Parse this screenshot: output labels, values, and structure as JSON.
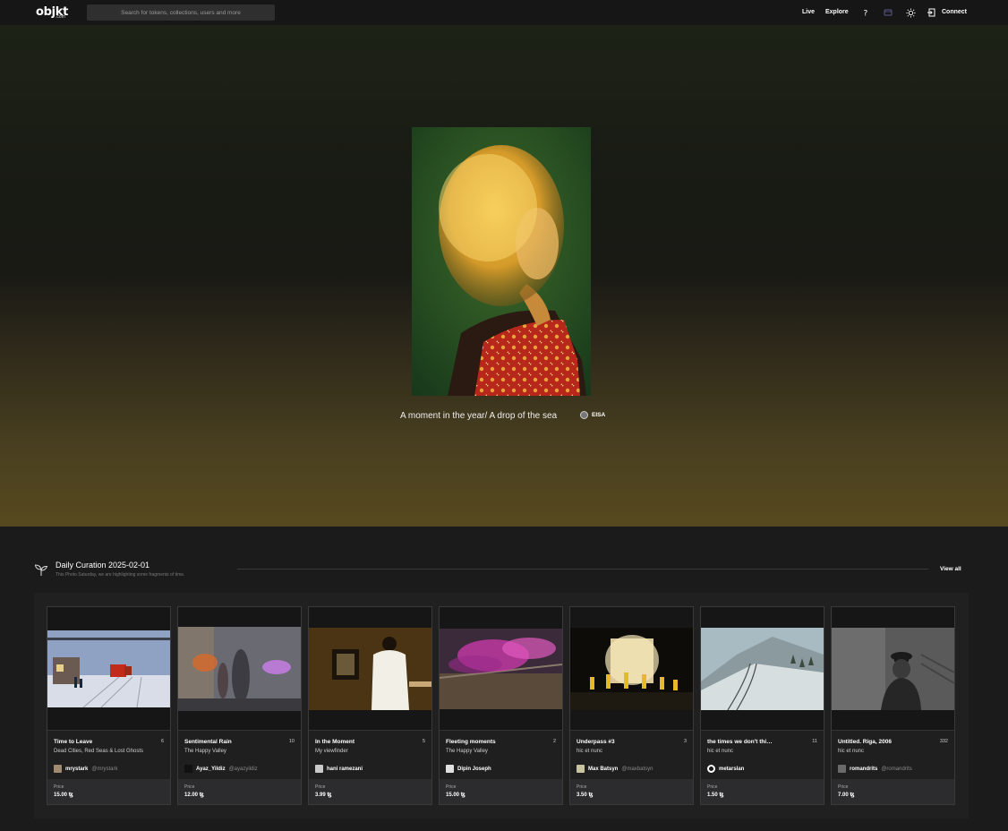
{
  "nav": {
    "logo": "objkt",
    "logo_sub": ".com",
    "search_placeholder": "Search for tokens, collections, users and more",
    "links": [
      "Live",
      "Explore"
    ],
    "connect_label": "Connect"
  },
  "hero": {
    "title": "A moment in the year/ A drop of the sea",
    "artist": "EISA"
  },
  "curation": {
    "title": "Daily Curation 2025-02-01",
    "subtitle": "This Photo Saturday, we are highlighting some fragments of time.",
    "view_all": "View all",
    "price_label": "Price",
    "cards": [
      {
        "title": "Time to Leave",
        "editions": "6",
        "collection": "Dead Cities, Red Seas & Lost Ghosts",
        "artist": "mrystark",
        "handle": "@mrystark",
        "price": "15.00 ꜩ"
      },
      {
        "title": "Sentimental Rain",
        "editions": "10",
        "collection": "The Happy Valley",
        "artist": "Ayaz_Yildiz",
        "handle": "@ayazyildiz",
        "price": "12.00 ꜩ"
      },
      {
        "title": "In the Moment",
        "editions": "5",
        "collection": "My viewfinder",
        "artist": "hani ramezani",
        "handle": "",
        "price": "3.99 ꜩ"
      },
      {
        "title": "Fleeting moments",
        "editions": "2",
        "collection": "The Happy Valley",
        "artist": "Dipin Joseph",
        "handle": "",
        "price": "15.00 ꜩ"
      },
      {
        "title": "Underpass #3",
        "editions": "3",
        "collection": "hic et nunc",
        "artist": "Max Batsyn",
        "handle": "@maxbatsyn",
        "price": "3.50 ꜩ"
      },
      {
        "title": "the times we don't thi…",
        "editions": "11",
        "collection": "hic et nunc",
        "artist": "metarslan",
        "handle": "",
        "price": "1.50 ꜩ"
      },
      {
        "title": "Untitled. Riga, 2006",
        "editions": "332",
        "collection": "hic et nunc",
        "artist": "romandrits",
        "handle": "@romandrits",
        "price": "7.00 ꜩ"
      }
    ]
  }
}
